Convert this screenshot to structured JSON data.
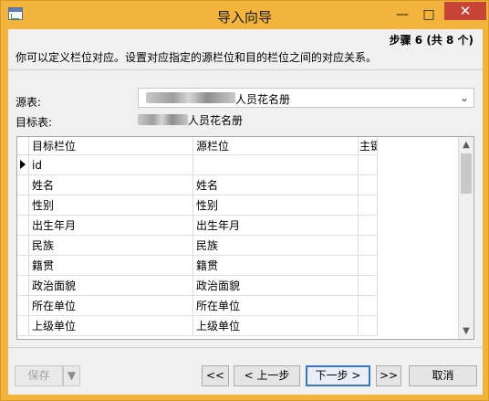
{
  "window": {
    "title": "导入向导",
    "minimize_label": "—",
    "maximize_label": "□",
    "close_label": "✕"
  },
  "wizard": {
    "step": "步骤 6 (共 8 个)",
    "instruction": "你可以定义栏位对应。设置对应指定的源栏位和目的栏位之间的对应关系。",
    "source_label": "源表:",
    "source_value": "人员花名册",
    "source_arrow": "⌄",
    "target_label": "目标表:",
    "target_value": "人员花名册"
  },
  "grid": {
    "headers": [
      "目标栏位",
      "源栏位",
      "主键"
    ],
    "rows": [
      {
        "target": "id",
        "source": "",
        "key": ""
      },
      {
        "target": "姓名",
        "source": "姓名",
        "key": ""
      },
      {
        "target": "性别",
        "source": "性别",
        "key": ""
      },
      {
        "target": "出生年月",
        "source": "出生年月",
        "key": ""
      },
      {
        "target": "民族",
        "source": "民族",
        "key": ""
      },
      {
        "target": "籍贯",
        "source": "籍贯",
        "key": ""
      },
      {
        "target": "政治面貌",
        "source": "政治面貌",
        "key": ""
      },
      {
        "target": "所在单位",
        "source": "所在单位",
        "key": ""
      },
      {
        "target": "上级单位",
        "source": "上级单位",
        "key": ""
      }
    ],
    "scroll_up": "▲",
    "scroll_down": "▼"
  },
  "buttons": {
    "save": "保存",
    "save_dropdown": "▼",
    "first": "<<",
    "previous": "< 上一步",
    "next": "下一步 >",
    "last": ">>",
    "cancel": "取消"
  }
}
